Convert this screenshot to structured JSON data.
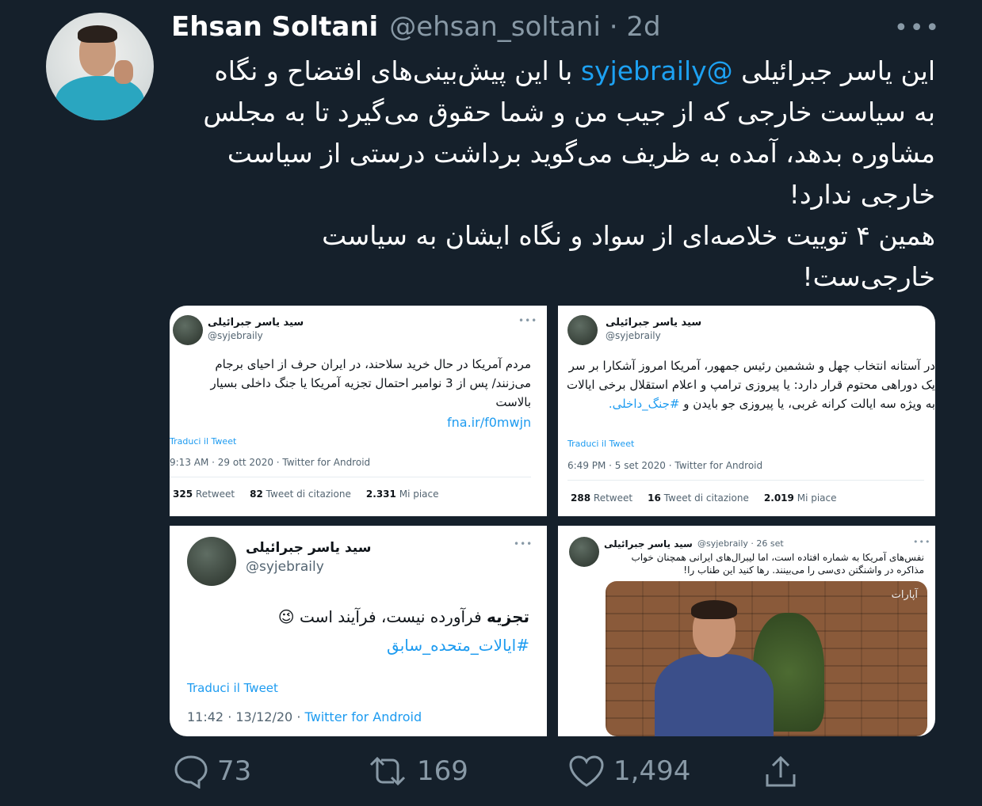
{
  "author": {
    "name": "Ehsan Soltani",
    "handle": "@ehsan_soltani",
    "time": "· 2d"
  },
  "more_icon": "•••",
  "tweet": {
    "text_before": "این یاسر جبرائیلی ",
    "mention": "@syjebraily",
    "text_after": " با این پیش‌بینی‌های افتضاح و نگاه به سیاست خارجی که از جیب من و شما حقوق می‌گیرد تا به مجلس مشاوره بدهد، آمده به ظریف می‌گوید برداشت درستی از سیاست خارجی ندارد!",
    "text_line2": "همین ۴ توییت خلاصه‌ای از سواد و نگاه ایشان به سیاست خارجی‌ست!"
  },
  "embeds": [
    {
      "name": "سید یاسر جبرائیلی",
      "handle": "@syjebraily",
      "dots": "•••",
      "text": "مردم آمریکا در حال خرید سلاحند، در ایران حرف از احیای برجام می‌زنند/ پس از 3 نوامبر احتمال تجزیه آمریکا یا جنگ داخلی بسیار بالاست",
      "link": "fna.ir/f0mwjn",
      "translate": "Traduci il Tweet",
      "meta": "9:13 AM · 29 ott 2020 · Twitter for Android",
      "retweets": "325",
      "retweets_label": "Retweet",
      "quotes": "82",
      "quotes_label": "Tweet di citazione",
      "likes": "2.331",
      "likes_label": "Mi piace"
    },
    {
      "name": "سید یاسر جبرائیلی",
      "handle": "@syjebraily",
      "dots": "•••",
      "text": "در آستانه انتخاب چهل و ششمین رئیس جمهور، آمریکا امروز آشکارا بر سر یک دوراهی محتوم قرار دارد: یا پیروزی ترامپ و اعلام استقلال برخی ایالات به ویژه سه ایالت کرانه غربی، یا پیروزی جو بایدن و",
      "hashtag": "#جنگ_داخلی.",
      "translate": "Traduci il Tweet",
      "meta": "6:49 PM · 5 set 2020 · Twitter for Android",
      "retweets": "288",
      "retweets_label": "Retweet",
      "quotes": "16",
      "quotes_label": "Tweet di citazione",
      "likes": "2.019",
      "likes_label": "Mi piace"
    },
    {
      "name": "سید یاسر جبرائیلی",
      "handle": "@syjebraily",
      "dots": "•••",
      "text_bold": "تجزیه",
      "text": " فرآورده نیست، فرآیند است 😉",
      "hashtag": "#ایالات_متحده_سابق",
      "translate": "Traduci il Tweet",
      "meta_time": "11:42 · 13/12/20 · ",
      "meta_source": "Twitter for Android"
    },
    {
      "name": "سید یاسر جبرائیلی",
      "handle": "@syjebraily · 26 set",
      "dots": "•••",
      "text": "نفس‌های آمریکا به شماره افتاده است، اما لیبرال‌های ایرانی همچنان خواب مذاکره در واشنگتن دی‌سی را می‌بینند. رها کنید این طناب را!",
      "watermark": "آپارات"
    }
  ],
  "actions": {
    "replies": "73",
    "retweets": "169",
    "likes": "1,494"
  },
  "icons": [
    "reply-icon",
    "retweet-icon",
    "like-icon",
    "share-icon"
  ]
}
